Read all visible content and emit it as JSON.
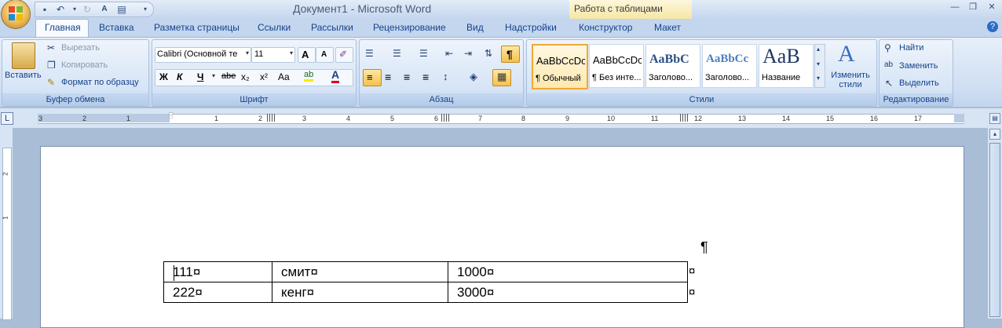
{
  "window": {
    "title": "Документ1 - Microsoft Word",
    "contextual_header": "Работа с таблицами",
    "qat_icons": [
      "save-icon",
      "undo-icon",
      "redo-icon",
      "spelling-icon",
      "paste-icon",
      "customize-qat-icon"
    ]
  },
  "tabs": [
    "Главная",
    "Вставка",
    "Разметка страницы",
    "Ссылки",
    "Рассылки",
    "Рецензирование",
    "Вид",
    "Надстройки",
    "Конструктор",
    "Макет"
  ],
  "active_tab": "Главная",
  "ribbon": {
    "clipboard": {
      "label": "Буфер обмена",
      "paste": "Вставить",
      "cut": "Вырезать",
      "copy": "Копировать",
      "format_painter": "Формат по образцу"
    },
    "font": {
      "label": "Шрифт",
      "font_name": "Calibri (Основной те",
      "font_size": "11",
      "grow": "A",
      "shrink": "A",
      "bold": "Ж",
      "italic": "К",
      "underline": "Ч",
      "strike": "abe",
      "subscript": "x₂",
      "superscript": "x²",
      "change_case": "Aa"
    },
    "paragraph": {
      "label": "Абзац",
      "show_marks": "¶"
    },
    "styles": {
      "label": "Стили",
      "items": [
        {
          "sample": "AaBbCcDc",
          "name": "¶ Обычный"
        },
        {
          "sample": "AaBbCcDc",
          "name": "¶ Без инте..."
        },
        {
          "sample": "AaBbC",
          "name": "Заголово..."
        },
        {
          "sample": "AaBbCc",
          "name": "Заголово..."
        },
        {
          "sample": "AaB",
          "name": "Название"
        }
      ],
      "change_styles": "Изменить стили"
    },
    "editing": {
      "label": "Редактирование",
      "find": "Найти",
      "replace": "Заменить",
      "select": "Выделить"
    }
  },
  "ruler": {
    "left_ticks": [
      "3",
      "2",
      "1"
    ],
    "right_ticks": [
      "1",
      "2",
      "3",
      "4",
      "5",
      "6",
      "7",
      "8",
      "9",
      "10",
      "11",
      "12",
      "13",
      "14",
      "15",
      "16",
      "17"
    ],
    "vertical_ticks": [
      "2",
      "1"
    ]
  },
  "document": {
    "paragraph_mark": "¶",
    "cell_mark": "¤",
    "table": [
      [
        "111¤",
        "смит¤",
        "1000¤"
      ],
      [
        "222¤",
        "кенг¤",
        "3000¤"
      ]
    ],
    "row_end_marks": [
      "¤",
      "¤"
    ]
  }
}
